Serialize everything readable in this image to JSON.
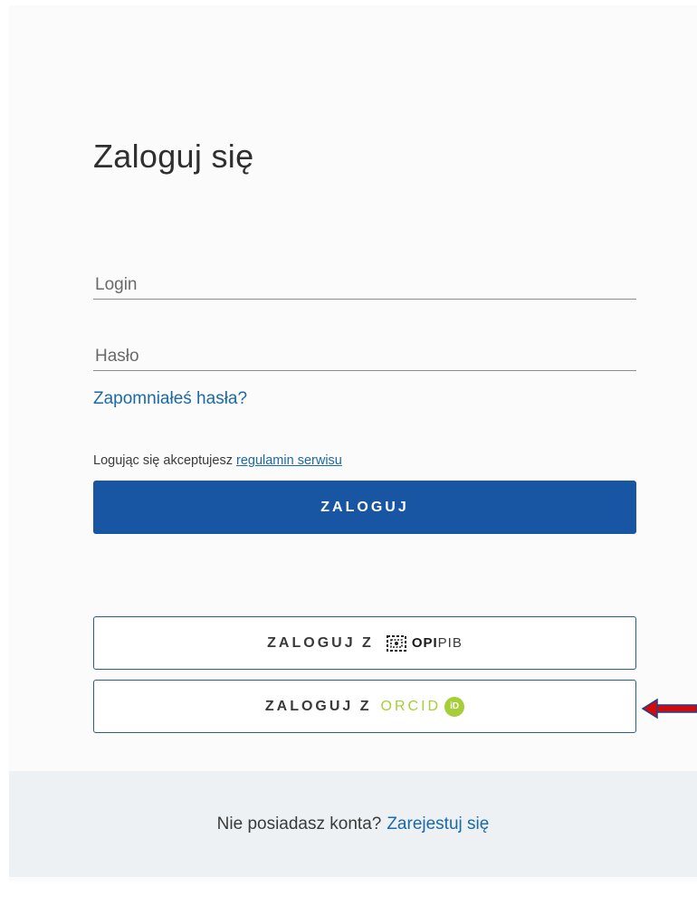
{
  "login_form": {
    "title": "Zaloguj się",
    "login_placeholder": "Login",
    "password_placeholder": "Hasło",
    "forgot_password": "Zapomniałeś hasła?",
    "terms_prefix": "Logując się akceptujesz",
    "terms_link": "regulamin serwisu",
    "submit_label": "ZALOGUJ"
  },
  "sso": {
    "opi_prefix": "ZALOGUJ Z",
    "opi_brand_bold": "OPI",
    "opi_brand_light": "PIB",
    "orcid_prefix": "ZALOGUJ Z",
    "orcid_brand": "ORCID",
    "orcid_badge": "iD"
  },
  "footer": {
    "question": "Nie posiadasz konta?",
    "register_link": "Zarejestuj się"
  },
  "colors": {
    "primary": "#1855a3",
    "link": "#1a6aa8",
    "orcid_green": "#a6ce39",
    "annotation_arrow": "#d10a0a"
  },
  "icons": {
    "opi_logo": "opi-logo-icon",
    "orcid_badge": "orcid-id-icon",
    "annotation": "left-arrow-icon"
  }
}
